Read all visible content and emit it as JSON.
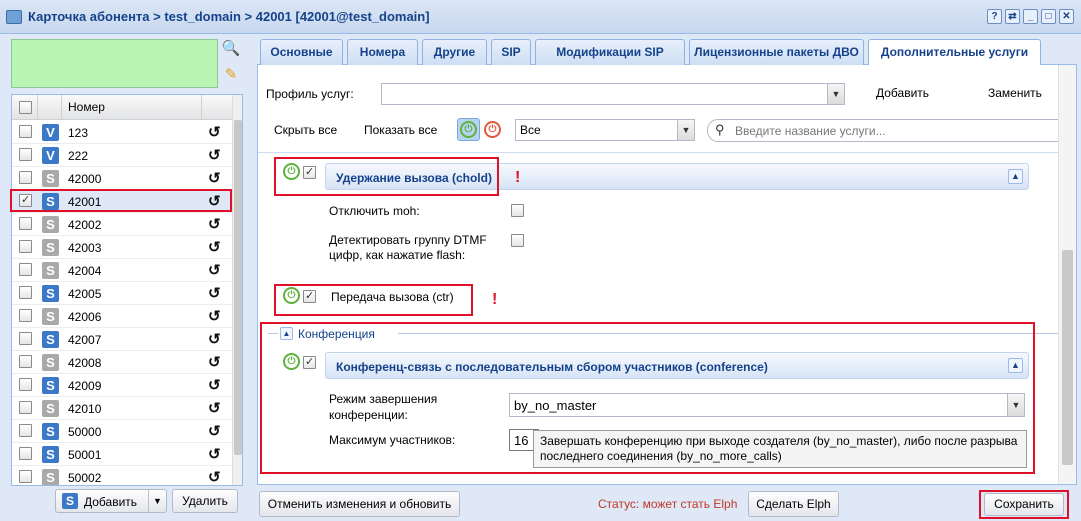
{
  "window": {
    "title": "Карточка абонента > test_domain > 42001 [42001@test_domain]",
    "controls": [
      "?",
      "⇄",
      "_",
      "□",
      "✕"
    ]
  },
  "left": {
    "column_header": "Номер",
    "rows": [
      {
        "number": "123",
        "icon": "V",
        "icon_style": "v",
        "checked": false
      },
      {
        "number": "222",
        "icon": "V",
        "icon_style": "v",
        "checked": false
      },
      {
        "number": "42000",
        "icon": "S",
        "icon_style": "s",
        "checked": false
      },
      {
        "number": "42001",
        "icon": "S",
        "icon_style": "sb",
        "checked": true
      },
      {
        "number": "42002",
        "icon": "S",
        "icon_style": "s",
        "checked": false
      },
      {
        "number": "42003",
        "icon": "S",
        "icon_style": "s",
        "checked": false
      },
      {
        "number": "42004",
        "icon": "S",
        "icon_style": "s",
        "checked": false
      },
      {
        "number": "42005",
        "icon": "S",
        "icon_style": "sb",
        "checked": false
      },
      {
        "number": "42006",
        "icon": "S",
        "icon_style": "s",
        "checked": false
      },
      {
        "number": "42007",
        "icon": "S",
        "icon_style": "sb",
        "checked": false
      },
      {
        "number": "42008",
        "icon": "S",
        "icon_style": "s",
        "checked": false
      },
      {
        "number": "42009",
        "icon": "S",
        "icon_style": "sb",
        "checked": false
      },
      {
        "number": "42010",
        "icon": "S",
        "icon_style": "s",
        "checked": false
      },
      {
        "number": "50000",
        "icon": "S",
        "icon_style": "sb",
        "checked": false
      },
      {
        "number": "50001",
        "icon": "S",
        "icon_style": "sb",
        "checked": false
      },
      {
        "number": "50002",
        "icon": "S",
        "icon_style": "s",
        "checked": false
      }
    ],
    "add_label": "Добавить",
    "delete_label": "Удалить"
  },
  "tabs": [
    "Основные",
    "Номера",
    "Другие",
    "SIP",
    "Модификации SIP",
    "Лицензионные пакеты ДВО",
    "Дополнительные услуги"
  ],
  "active_tab": 6,
  "toolbar": {
    "profile_label": "Профиль услуг:",
    "profile_value": "",
    "add": "Добавить",
    "replace": "Заменить",
    "hide_all": "Скрыть все",
    "show_all": "Показать все",
    "filter_value": "Все",
    "search_placeholder": "Введите название услуги..."
  },
  "services": {
    "chold": {
      "title": "Удержание вызова (chold)",
      "enabled": true,
      "opt_moh": "Отключить moh:",
      "opt_dtmf_1": "Детектировать группу DTMF",
      "opt_dtmf_2": "цифр, как нажатие flash:"
    },
    "ctr": {
      "title": "Передача вызова (ctr)",
      "enabled": true
    },
    "group_conference": "Конференция",
    "conference": {
      "title": "Конференц-связь с последовательным сбором участников (conference)",
      "enabled": true,
      "mode_label_1": "Режим завершения",
      "mode_label_2": "конференции:",
      "mode_value": "by_no_master",
      "max_label": "Максимум участников:",
      "max_value": "16"
    },
    "excl": "!"
  },
  "tooltip": {
    "line1": "Завершать конференцию при выходе создателя (by_no_master), либо после разрыва",
    "line2": "последнего соединения (by_no_more_calls)"
  },
  "footer": {
    "cancel_refresh": "Отменить изменения и обновить",
    "status": "Статус: может стать Elph",
    "make_elph": "Сделать Elph",
    "save": "Сохранить"
  },
  "colors": {
    "status_text": "#c0392b",
    "highlight": "#e0102a",
    "accent": "#15428b"
  }
}
